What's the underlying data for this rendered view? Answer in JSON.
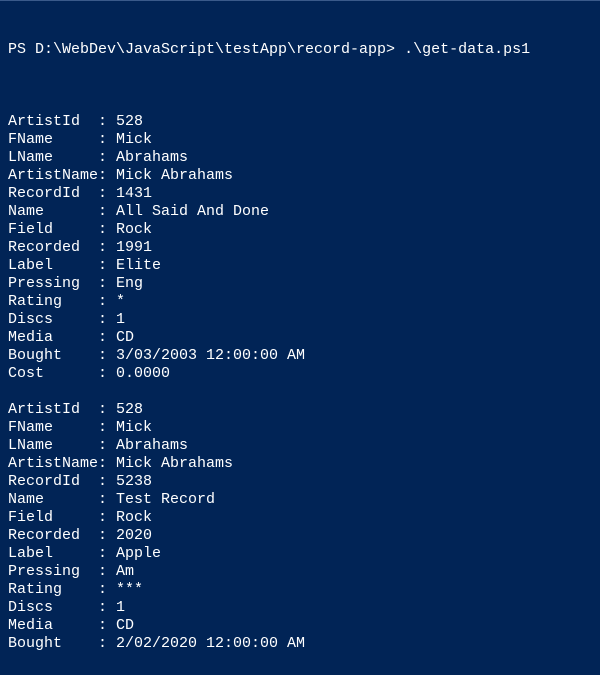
{
  "prompt": "PS D:\\WebDev\\JavaScript\\testApp\\record-app> ",
  "command": ".\\get-data.ps1",
  "separator": ": ",
  "records": [
    {
      "fields": [
        {
          "key": "ArtistId",
          "value": "528"
        },
        {
          "key": "FName",
          "value": "Mick"
        },
        {
          "key": "LName",
          "value": "Abrahams"
        },
        {
          "key": "ArtistName",
          "value": "Mick Abrahams"
        },
        {
          "key": "RecordId",
          "value": "1431"
        },
        {
          "key": "Name",
          "value": "All Said And Done"
        },
        {
          "key": "Field",
          "value": "Rock"
        },
        {
          "key": "Recorded",
          "value": "1991"
        },
        {
          "key": "Label",
          "value": "Elite"
        },
        {
          "key": "Pressing",
          "value": "Eng"
        },
        {
          "key": "Rating",
          "value": "*"
        },
        {
          "key": "Discs",
          "value": "1"
        },
        {
          "key": "Media",
          "value": "CD"
        },
        {
          "key": "Bought",
          "value": "3/03/2003 12:00:00 AM"
        },
        {
          "key": "Cost",
          "value": "0.0000"
        }
      ]
    },
    {
      "fields": [
        {
          "key": "ArtistId",
          "value": "528"
        },
        {
          "key": "FName",
          "value": "Mick"
        },
        {
          "key": "LName",
          "value": "Abrahams"
        },
        {
          "key": "ArtistName",
          "value": "Mick Abrahams"
        },
        {
          "key": "RecordId",
          "value": "5238"
        },
        {
          "key": "Name",
          "value": "Test Record"
        },
        {
          "key": "Field",
          "value": "Rock"
        },
        {
          "key": "Recorded",
          "value": "2020"
        },
        {
          "key": "Label",
          "value": "Apple"
        },
        {
          "key": "Pressing",
          "value": "Am"
        },
        {
          "key": "Rating",
          "value": "***"
        },
        {
          "key": "Discs",
          "value": "1"
        },
        {
          "key": "Media",
          "value": "CD"
        },
        {
          "key": "Bought",
          "value": "2/02/2020 12:00:00 AM"
        }
      ]
    }
  ]
}
